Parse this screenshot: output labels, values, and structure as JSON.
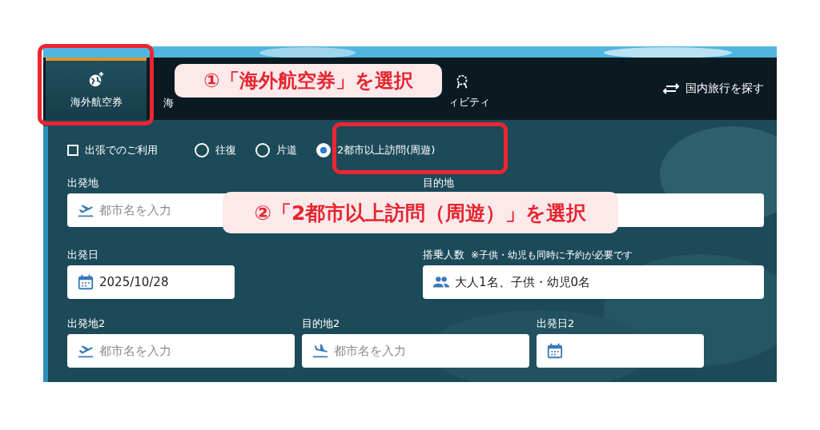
{
  "nav": {
    "tabs": [
      {
        "label": "海外航空券",
        "selected": true
      },
      {
        "label": "海",
        "selected": false
      },
      {
        "label": "ィビティ",
        "selected": false
      }
    ],
    "domestic_link": "国内旅行を探す"
  },
  "options": {
    "business": {
      "label": "出張でのご利用",
      "checked": false
    },
    "trip_types": [
      {
        "label": "往復",
        "selected": false
      },
      {
        "label": "片道",
        "selected": false
      },
      {
        "label": "2都市以上訪問(周遊)",
        "selected": true
      }
    ]
  },
  "field_rows": [
    {
      "fields": [
        {
          "label": "出発地",
          "kind": "departure",
          "placeholder": "都市名を入力"
        },
        {
          "label": "目的地",
          "kind": "blank"
        }
      ]
    },
    {
      "fields": [
        {
          "label": "出発日",
          "kind": "date",
          "value": "2025/10/28"
        },
        {
          "label": "搭乗人数",
          "note": "※子供・幼児も同時に予約が必要です",
          "kind": "passengers",
          "value": "大人1名、子供・幼児0名"
        }
      ]
    },
    {
      "fields": [
        {
          "label": "出発地2",
          "kind": "departure",
          "placeholder": "都市名を入力"
        },
        {
          "label": "目的地2",
          "kind": "destination",
          "placeholder": "都市名を入力"
        },
        {
          "label": "出発日2",
          "kind": "date"
        }
      ]
    }
  ],
  "annotations": [
    {
      "text": "①「海外航空券」を選択"
    },
    {
      "text": "②「2都市以上訪問（周遊）」を選択"
    }
  ]
}
